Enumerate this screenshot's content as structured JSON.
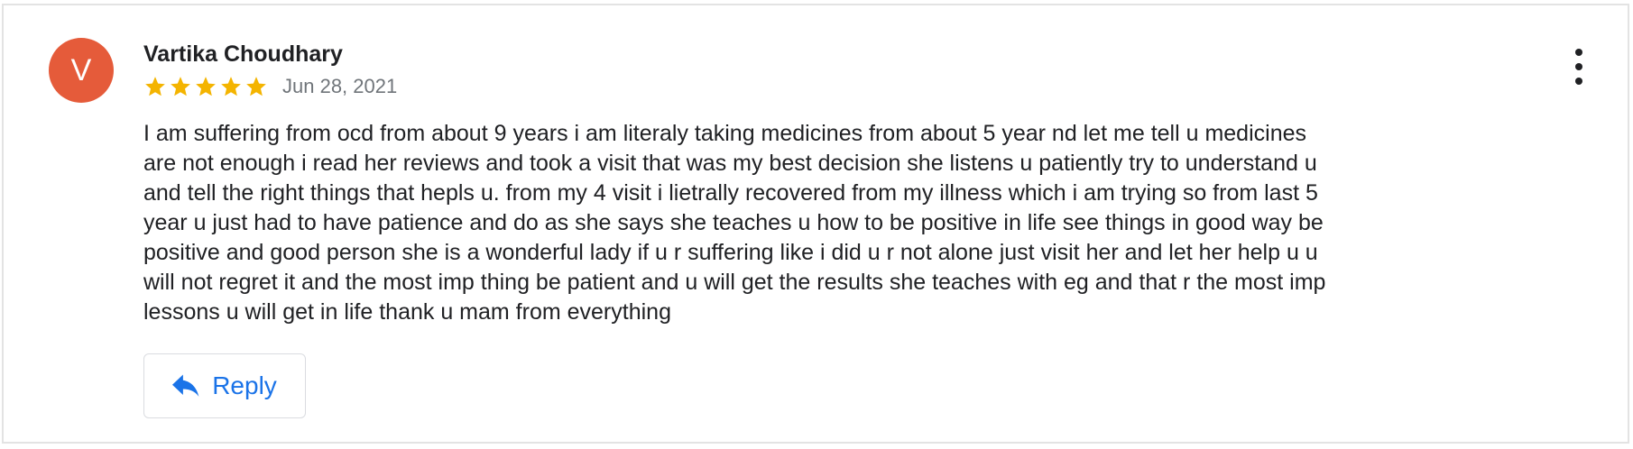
{
  "reviewer": {
    "avatar_letter": "V",
    "avatar_color": "#e55b3a",
    "name": "Vartika Choudhary"
  },
  "review": {
    "rating": 5,
    "max_rating": 5,
    "star_color": "#f4b400",
    "date": "Jun 28, 2021",
    "text": "I am suffering from ocd from about 9 years i am literaly taking medicines from about 5 year nd let me tell u medicines\nare not enough i read her reviews and took a visit that was my best decision she listens u patiently try to understand u\nand tell the right things that hepls u. from my 4 visit i lietrally recovered from my illness which i am trying so from last 5\nyear u just had to have patience and do as she says she teaches u how to be positive in life see things in good way be\npositive and good person she is a wonderful lady if u r suffering like i did u r not alone just visit her and let her help u u\nwill not regret it and the most imp thing be patient and u will get the results she teaches with eg and that r the most imp\nlessons u will get in life thank u mam from everything"
  },
  "actions": {
    "reply_label": "Reply",
    "reply_icon": "reply-arrow-icon",
    "menu_icon": "more-vertical-icon",
    "accent_color": "#1a73e8"
  }
}
